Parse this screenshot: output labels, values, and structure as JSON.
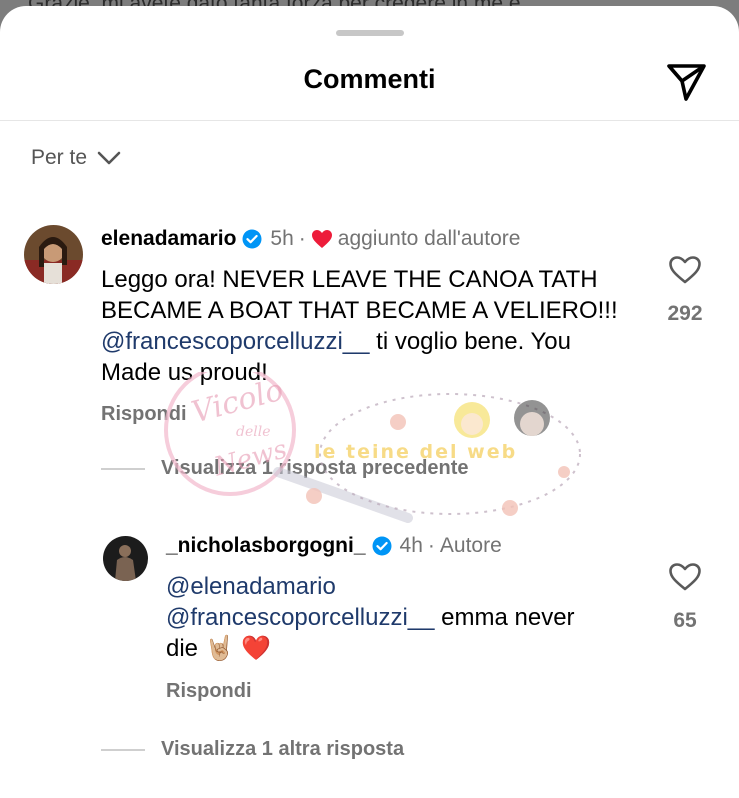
{
  "background_text": "Grazie, mi avete dato tanta forza per credere in me e",
  "header": {
    "title": "Commenti"
  },
  "filter": {
    "label": "Per te"
  },
  "comments": [
    {
      "username": "elenadamario",
      "time": "5h",
      "author_badge": "aggiunto dall'autore",
      "text_part1": "Leggo ora! NEVER LEAVE THE CANOA TATH BECAME A BOAT THAT BECAME A VELIERO!!! ",
      "mention": "@francescoporcelluzzi__",
      "text_part2": " ti voglio bene. You Made us proud!",
      "reply_label": "Rispondi",
      "likes": "292",
      "view_replies": "Visualizza 1 risposta precedente"
    },
    {
      "username": "_nicholasborgogni_",
      "time": "4h",
      "author_badge": "Autore",
      "mention1": "@elenadamario",
      "mention2": "@francescoporcelluzzi__",
      "text": " emma never die ",
      "emoji": "🤘🏼 ❤️",
      "reply_label": "Rispondi",
      "likes": "65",
      "view_replies": "Visualizza 1 altra risposta"
    }
  ],
  "watermark": {
    "left_lines": [
      "Vicolo",
      "delle",
      "News"
    ],
    "right_text": "le teine del web"
  },
  "colors": {
    "verified": "#0095f6",
    "heart": "#ed1c3a",
    "secondary": "#737373"
  }
}
